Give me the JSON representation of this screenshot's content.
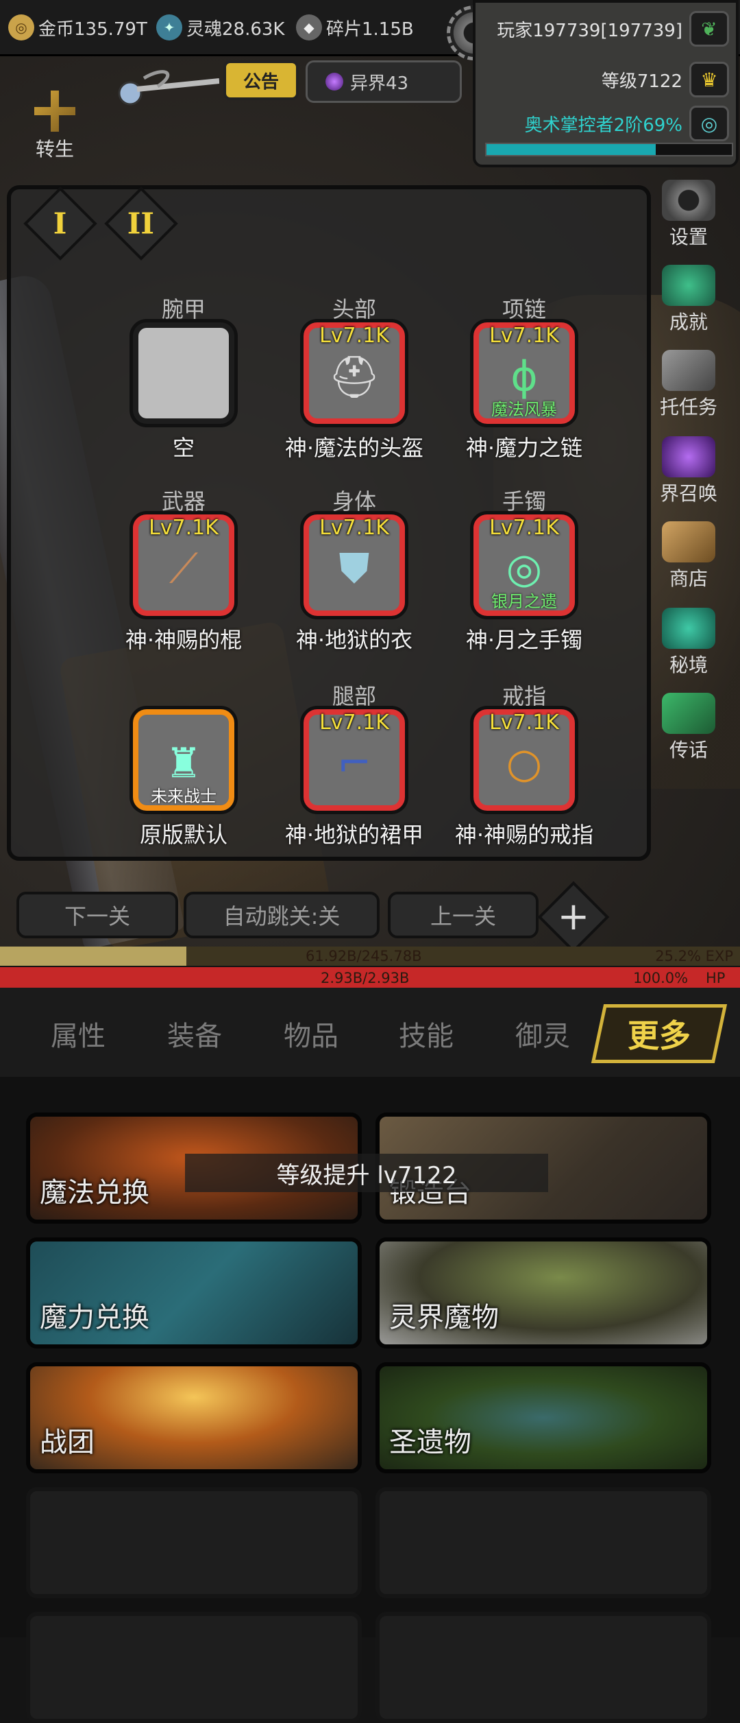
{
  "top": {
    "gold": "金币135.79T",
    "soul": "灵魂28.63K",
    "shards": "碎片1.15B"
  },
  "player": {
    "name": "玩家197739[197739]",
    "level": "等级7122",
    "class": "奥术掌控者2阶69%",
    "class_progress": 0.69
  },
  "notice": {
    "label": "公告"
  },
  "realm": {
    "label": "异界43"
  },
  "rebirth": {
    "label": "转生"
  },
  "right_menu": [
    "设置",
    "成就",
    "托任务",
    "界召唤",
    "商店",
    "秘境",
    "传话"
  ],
  "equip": {
    "tabs": [
      "I",
      "II"
    ],
    "slots": [
      {
        "category": "腕甲",
        "level": "",
        "name": "空",
        "sub": ""
      },
      {
        "category": "头部",
        "level": "Lv7.1K",
        "name": "神·魔法的头盔",
        "sub": ""
      },
      {
        "category": "项链",
        "level": "Lv7.1K",
        "name": "神·魔力之链",
        "sub": "魔法风暴"
      },
      {
        "category": "武器",
        "level": "Lv7.1K",
        "name": "神·神赐的棍",
        "sub": ""
      },
      {
        "category": "身体",
        "level": "Lv7.1K",
        "name": "神·地狱的衣",
        "sub": ""
      },
      {
        "category": "手镯",
        "level": "Lv7.1K",
        "name": "神·月之手镯",
        "sub": "银月之遗"
      },
      {
        "category": "",
        "level": "",
        "name": "原版默认",
        "sub": "未来战士"
      },
      {
        "category": "腿部",
        "level": "Lv7.1K",
        "name": "神·地狱的裙甲",
        "sub": ""
      },
      {
        "category": "戒指",
        "level": "Lv7.1K",
        "name": "神·神赐的戒指",
        "sub": ""
      }
    ]
  },
  "stage": {
    "prev": "下一关",
    "auto": "自动跳关:关",
    "next": "上一关"
  },
  "exp": {
    "value": "61.92B/245.78B",
    "pct": "25.2% EXP",
    "fraction": 0.252
  },
  "hp": {
    "value": "2.93B/2.93B",
    "pct": "100.0%",
    "unit": "HP"
  },
  "tabs": [
    "属性",
    "装备",
    "物品",
    "技能",
    "御灵",
    "更多"
  ],
  "cards": [
    "魔法兑换",
    "锻造台",
    "魔力兑换",
    "灵界魔物",
    "战团",
    "圣遗物"
  ],
  "toast": "等级提升 lv7122",
  "colors": {
    "accent": "#d3b33b",
    "hp": "#c62828",
    "slot_border": "#dd3333",
    "xp": "#19a8b0"
  }
}
